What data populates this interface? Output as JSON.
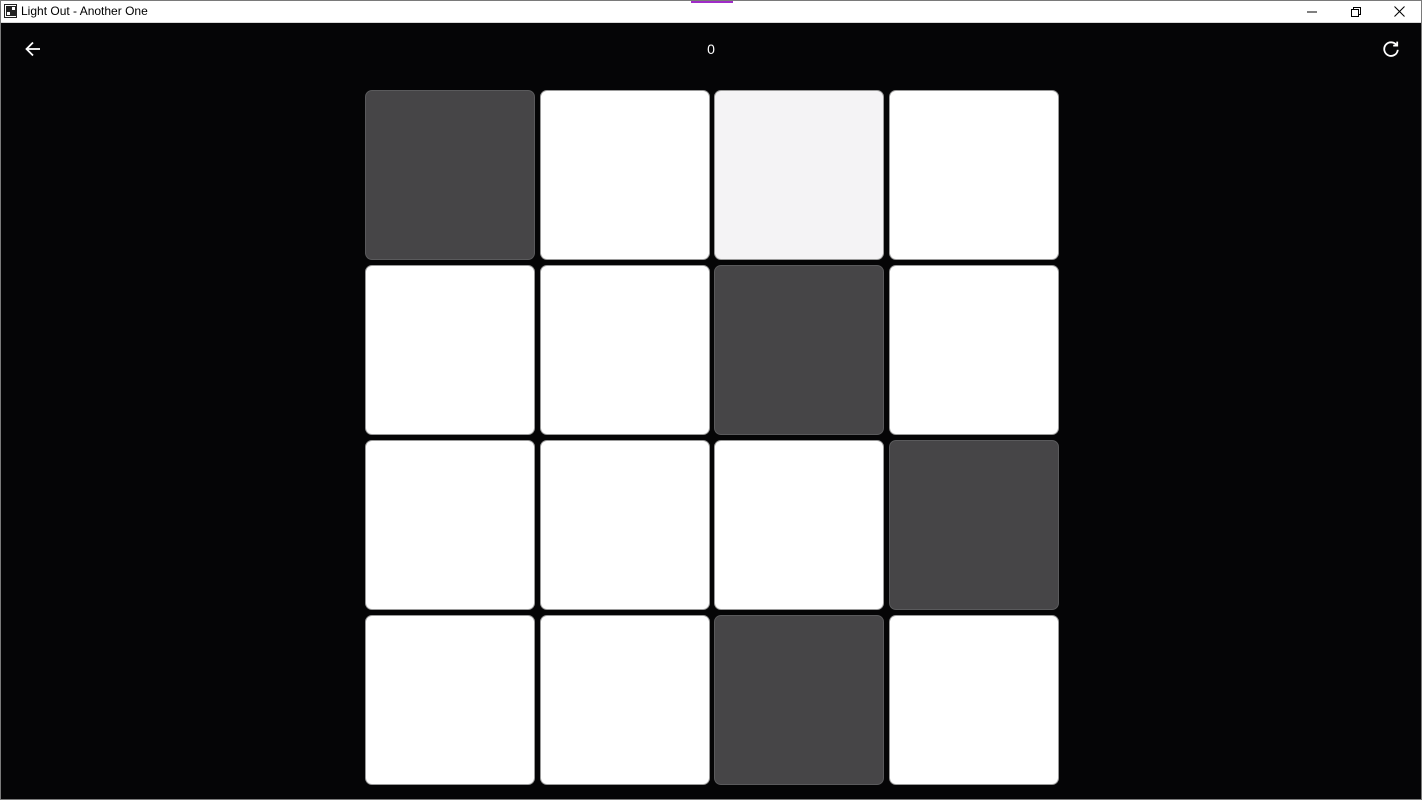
{
  "window": {
    "title": "Light Out - Another One",
    "accent_color": "#a02cc8"
  },
  "header": {
    "back_icon": "arrow-left-icon",
    "moves": "0",
    "refresh_icon": "refresh-icon"
  },
  "board": {
    "rows": 4,
    "cols": 4,
    "colors": {
      "on": "#ffffff",
      "off": "#464547",
      "hover": "#f4f3f5"
    },
    "cells": [
      [
        "off",
        "on",
        "hover",
        "on"
      ],
      [
        "on",
        "on",
        "off",
        "on"
      ],
      [
        "on",
        "on",
        "on",
        "off"
      ],
      [
        "on",
        "on",
        "off",
        "on"
      ]
    ]
  }
}
